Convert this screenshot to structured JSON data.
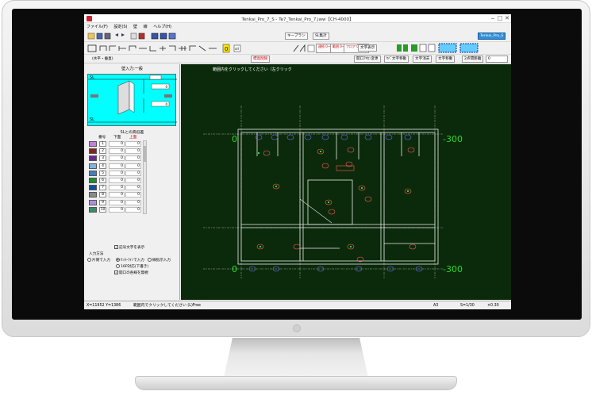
{
  "window": {
    "title": "Tenkai_Pro_7_S - Te7_Tenkai_Pro_7.jww【CH-4000】",
    "controls": [
      "‒",
      "□",
      "✕"
    ]
  },
  "menu": [
    "ファイル(F)",
    "設定(S)",
    "壁",
    "線",
    "ヘルプ(H)"
  ],
  "toolbar1": {
    "keyplan": "キープラン",
    "sl_calc": "SL集計",
    "layer_box": "Tenkai_Pro_S"
  },
  "toolbar2": {
    "text_display": "文字表示",
    "buttons": [
      "連続 0~1Lx",
      "範囲 0~1Lx",
      "フロア 0~1Lx"
    ]
  },
  "toolbar3": {
    "mode": "(水平・垂直)",
    "pick_button": "標高削除",
    "opening_button": "開口ｱｷｶﾝ変更",
    "text_move": "ｾﾊﾞ文字移動",
    "text_erase": "文字消去",
    "text_move2": "文字移動",
    "interval_label": "2点間距離",
    "interval_value": "0"
  },
  "left_panel": {
    "title": "壁入力:一般",
    "sl_top": "SL",
    "sl_bottom": "SL",
    "dim_values": [
      "0",
      "0",
      "0",
      "0"
    ],
    "palette_title": "SLとの高低差",
    "col_num": "番号",
    "col_lower": "下面",
    "col_upper": "上面",
    "rows": [
      {
        "num": "1",
        "lower": "0",
        "upper": "0",
        "color": "#c77ddb"
      },
      {
        "num": "2",
        "lower": "0",
        "upper": "0",
        "color": "#8b1f1f"
      },
      {
        "num": "3",
        "lower": "0",
        "upper": "0",
        "color": "#6a2a8a"
      },
      {
        "num": "4",
        "lower": "0",
        "upper": "0",
        "color": "#7fb3e0"
      },
      {
        "num": "5",
        "lower": "0",
        "upper": "0",
        "color": "#3f7fc4"
      },
      {
        "num": "6",
        "lower": "0",
        "upper": "0",
        "color": "#1e8c2e"
      },
      {
        "num": "7",
        "lower": "0",
        "upper": "0",
        "color": "#0b4f9c"
      },
      {
        "num": "8",
        "lower": "0",
        "upper": "0",
        "color": "#8a8a8a"
      },
      {
        "num": "9",
        "lower": "0",
        "upper": "0",
        "color": "#b08ee0"
      },
      {
        "num": "10",
        "lower": "0",
        "upper": "0",
        "color": "#3a8c6a"
      }
    ],
    "show_text_label": "記号文字を表示",
    "input_method_label": "入力方法",
    "radio_opts": [
      "片側で入力",
      "ｾﾝﾀｰﾗｲﾝで入力",
      "線指示入力",
      "16P対応(下書き)"
    ],
    "ignore_chk": "開口の各線を無視"
  },
  "canvas": {
    "message": "範囲内をクリックしてください（左クリック",
    "level_marks": [
      "0",
      "-300",
      "0",
      "-300"
    ]
  },
  "status": {
    "coords": "X=11952 Y=1386",
    "prompt": "範囲内でクリックしてください (L)Free",
    "paper": "A3",
    "scale": "S=1/30",
    "zoom": "×0.30"
  }
}
